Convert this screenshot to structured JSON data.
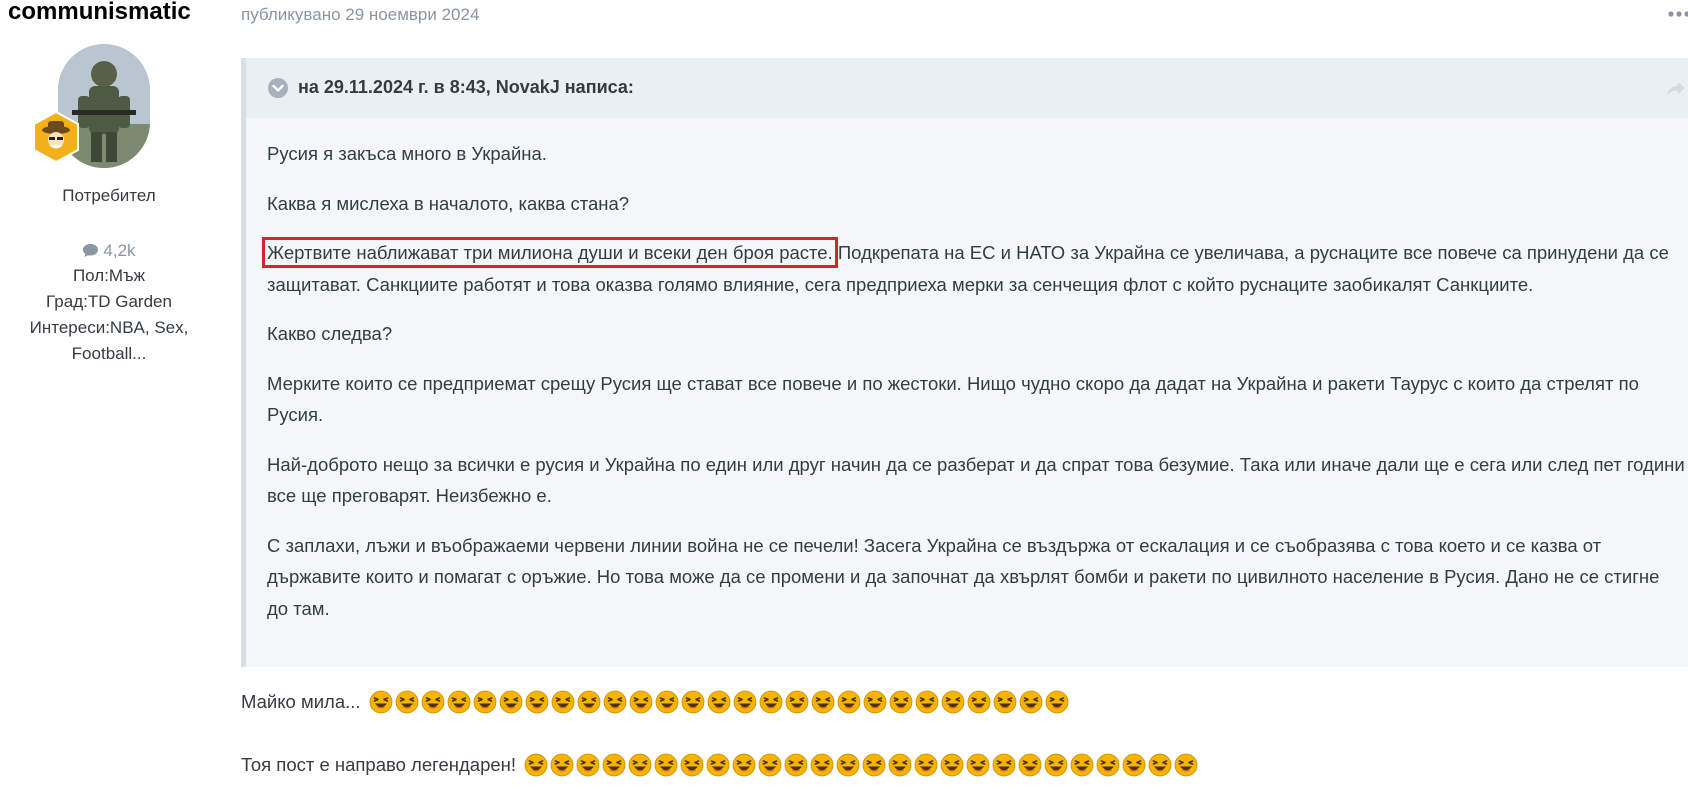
{
  "author": {
    "name": "communismatic",
    "group": "Потребител",
    "post_count": "4,2k",
    "gender": "Пол:Мъж",
    "city": "Град:TD Garden",
    "interests": "Интереси:NBA, Sex, Football..."
  },
  "post": {
    "date": "публикувано 29 ноември 2024"
  },
  "quote": {
    "citation": "на 29.11.2024 г. в 8:43, NovakJ написа:",
    "paragraphs": {
      "p1": "Русия я закъса много в Украйна.",
      "p2": "Каква я мислеха в началото, каква стана?",
      "p3_highlight": "Жертвите наближават три милиона души и всеки ден броя расте.",
      "p3_rest": " Подкрепата на ЕС и НАТО за Украйна се увеличава, а руснаците все повече са принудени да се защитават. Санкциите работят и това оказва голямо влияние, сега предприеха мерки за сенчещия флот с който руснаците заобикалят Санкциите.",
      "p4": "Какво следва?",
      "p5": "Мерките които се предприемат срещу Русия ще стават все повече и по жестоки. Нищо чудно скоро да дадат на Украйна и ракети Таурус с които да стрелят по Русия.",
      "p6": "Най-доброто нещо за всички е русия и Украйна по един или друг начин да се разберат и да спрат това безумие. Така или иначе дали ще е сега или след пет години все ще преговарят. Неизбежно е.",
      "p7": "С заплахи, лъжи и въображаеми червени линии война не се печели! Засега Украйна се въздържа от ескалация и се съобразява с това което и се казва от държавите които и помагат с оръжие. Но това може да се промени и да започнат да хвърлят бомби и ракети по цивилното население в Русия. Дано не се стигне до там."
    }
  },
  "reply": {
    "line1": "Майко мила...",
    "line1_emoji_count": 27,
    "line2": "Тоя пост е направо легендарен!",
    "line2_emoji_count": 26
  },
  "colors": {
    "highlight_border": "#d9232a",
    "quote_bg": "#f4f7fa",
    "quote_header_bg": "#eaeff3",
    "muted_text": "#8a96a3",
    "emoji_yellow": "#f4b400"
  },
  "icons": {
    "rank_badge": "cowboy-badge-icon",
    "post_count": "comment-bubble-icon",
    "quote_toggle": "chevron-down-icon",
    "share": "share-icon",
    "more": "ellipsis-icon",
    "emoji": "laughing-emoji-icon"
  }
}
